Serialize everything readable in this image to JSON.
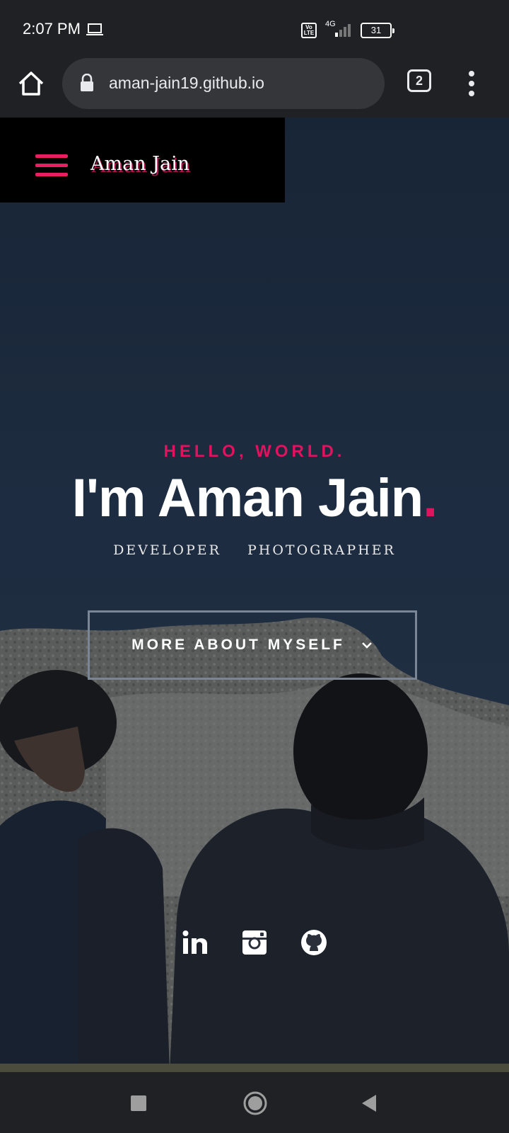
{
  "status_bar": {
    "time": "2:07 PM",
    "network": "4G",
    "volte": "Vo LTE",
    "battery": "31"
  },
  "browser": {
    "url": "aman-jain19.github.io",
    "tab_count": "2"
  },
  "site": {
    "name": "Aman Jain"
  },
  "hero": {
    "greeting": "HELLO, WORLD.",
    "title": "I'm Aman Jain",
    "title_dot": ".",
    "roles": [
      "DEVELOPER",
      "PHOTOGRAPHER"
    ],
    "cta_label": "MORE ABOUT MYSELF"
  },
  "socials": [
    "linkedin-icon",
    "instagram-icon",
    "github-icon"
  ],
  "colors": {
    "accent": "#e0135f",
    "header_bg": "#000000",
    "sky": "#223349"
  }
}
